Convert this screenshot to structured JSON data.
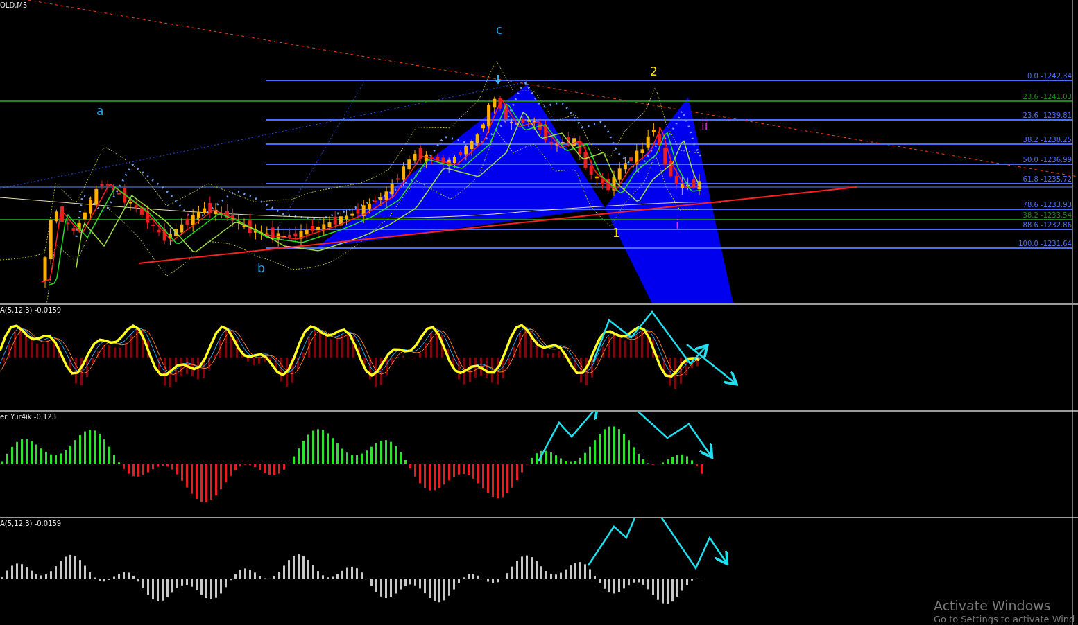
{
  "chart": {
    "title": "OLD,M5",
    "fib_levels": [
      {
        "label": "0.0 -1242.34",
        "color": "#4a6cff"
      },
      {
        "label": "23.6 -1241.03",
        "color": "#1a8a1a"
      },
      {
        "label": "23.6 -1239.81",
        "color": "#4a6cff"
      },
      {
        "label": "38.2 -1238.25",
        "color": "#4a6cff"
      },
      {
        "label": "50.0 -1236.99",
        "color": "#4a6cff"
      },
      {
        "label": "61.8 -1235.72",
        "color": "#4a6cff"
      },
      {
        "label": "78.6 -1233.93",
        "color": "#4a6cff"
      },
      {
        "label": "38.2 -1233.54",
        "color": "#1a8a1a"
      },
      {
        "label": "88.6 -1232.86",
        "color": "#4a6cff"
      },
      {
        "label": "100.0 -1231.64",
        "color": "#4a6cff"
      }
    ],
    "wave_labels": [
      {
        "label": "a",
        "color": "#1ea8f0"
      },
      {
        "label": "b",
        "color": "#1ea8f0"
      },
      {
        "label": "c",
        "color": "#1ea8f0"
      },
      {
        "label": "2",
        "color": "#f0e000"
      },
      {
        "label": "1",
        "color": "#f0e000"
      },
      {
        "label": "i",
        "color": "#e030e0"
      },
      {
        "label": "ii",
        "color": "#e030e0"
      }
    ]
  },
  "indicators": [
    {
      "title": "A(5,12,3) -0.0159",
      "kind": "oscillator"
    },
    {
      "title": "er_Yur4ik -0.123",
      "kind": "bars"
    },
    {
      "title": "A(5,12,3) -0.0159",
      "kind": "histogram"
    }
  ],
  "os_notice": {
    "title": "Activate Windows",
    "message": "Go to Settings to activate Wind"
  }
}
